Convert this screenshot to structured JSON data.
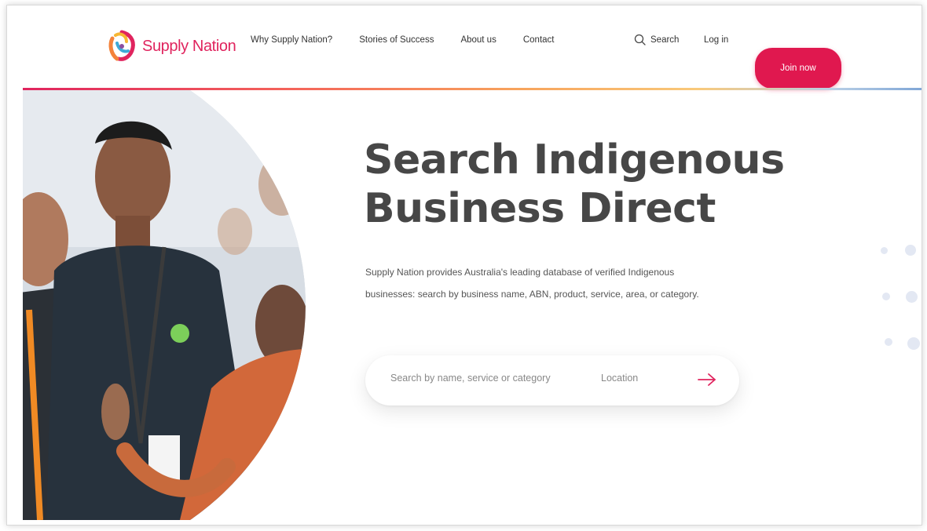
{
  "brand": {
    "name": "Supply Nation",
    "color": "#e0245e"
  },
  "nav": {
    "items": [
      {
        "label": "Why Supply Nation?"
      },
      {
        "label": "Stories of Success"
      },
      {
        "label": "About us"
      },
      {
        "label": "Contact"
      }
    ],
    "search_label": "Search",
    "login_label": "Log in",
    "join_label": "Join now",
    "join_color": "#e0184f"
  },
  "hero": {
    "title_line1": "Search Indigenous",
    "title_line2": "Business Direct",
    "description": "Supply Nation provides Australia's leading database of verified Indigenous businesses: search by business name, ABN, product, service, area, or category.",
    "image": {
      "description": "Two people in conversation at an event; a man wearing a dark shirt with a lanyard"
    }
  },
  "search": {
    "name_placeholder": "Search by name, service or category",
    "location_placeholder": "Location",
    "submit_icon": "arrow-right-icon",
    "accent_color": "#e0245e"
  }
}
